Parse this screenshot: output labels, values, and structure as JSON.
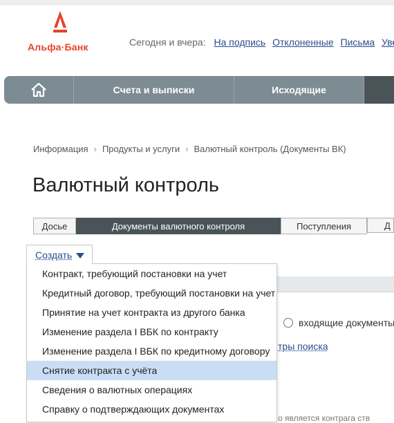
{
  "logo": {
    "text": "Альфа·Банк",
    "brand_color": "#e8412c"
  },
  "header": {
    "label": "Сегодня и вчера:",
    "links": [
      "На подпись",
      "Отклоненные",
      "Письма",
      "Уве"
    ]
  },
  "nav": {
    "home_icon": "home-icon",
    "items": [
      "Счета и выписки",
      "Исходящие"
    ]
  },
  "breadcrumb": [
    "Информация",
    "Продукты и услуги",
    "Валютный контроль (Документы ВК)"
  ],
  "page": {
    "title": "Валютный контроль"
  },
  "tabs": [
    {
      "label": "Досье",
      "active": false
    },
    {
      "label": "Документы валютного контроля",
      "active": true
    },
    {
      "label": "Поступления",
      "active": false
    },
    {
      "label": "Д",
      "active": false
    }
  ],
  "create": {
    "label": "Создать",
    "items": [
      {
        "label": "Контракт, требующий постановки на учет",
        "highlighted": false
      },
      {
        "label": "Кредитный договор, требующий постановки на учет",
        "highlighted": false
      },
      {
        "label": "Принятие на учет контракта из другого банка",
        "highlighted": false
      },
      {
        "label": "Изменение раздела I ВБК по контракту",
        "highlighted": false
      },
      {
        "label": "Изменение раздела I ВБК по кредитному договору",
        "highlighted": false
      },
      {
        "label": "Снятие контракта с учёта",
        "highlighted": true
      },
      {
        "label": "Сведения о валютных операциях",
        "highlighted": false
      },
      {
        "label": "Справку о подтверждающих документах",
        "highlighted": false
      }
    ]
  },
  "background": {
    "radio_label": "входящие документы",
    "search_link": "тры поиска",
    "bottom_text": "о является контрага ств"
  },
  "colors": {
    "nav_bg": "#7d8b92",
    "nav_dark": "#4a5358",
    "link": "#2a4d8f",
    "highlight": "#c9def5"
  }
}
